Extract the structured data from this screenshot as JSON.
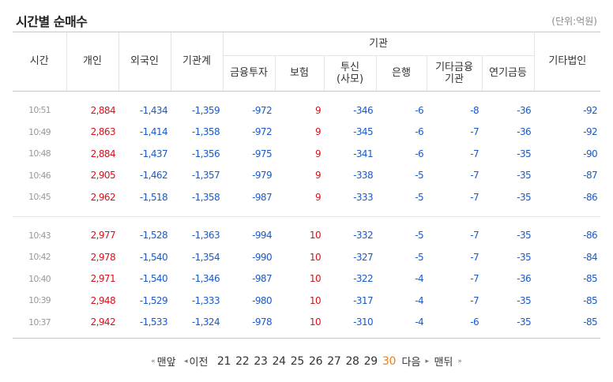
{
  "title": "시간별 순매수",
  "unit_label": "(단위:억원)",
  "columns": {
    "time": "시간",
    "individual": "개인",
    "foreign": "외국인",
    "institution_total": "기관계",
    "institution_group": "기관",
    "financial_invest": "금융투자",
    "insurance": "보험",
    "trust_line1": "투신",
    "trust_line2": "(사모)",
    "bank": "은행",
    "other_finance_line1": "기타금융",
    "other_finance_line2": "기관",
    "pension": "연기금등",
    "other_corp": "기타법인"
  },
  "rows": [
    [
      "10:51",
      "2,884",
      "-1,434",
      "-1,359",
      "-972",
      "9",
      "-346",
      "-6",
      "-8",
      "-36",
      "-92"
    ],
    [
      "10:49",
      "2,863",
      "-1,414",
      "-1,358",
      "-972",
      "9",
      "-345",
      "-6",
      "-7",
      "-36",
      "-92"
    ],
    [
      "10:48",
      "2,884",
      "-1,437",
      "-1,356",
      "-975",
      "9",
      "-341",
      "-6",
      "-7",
      "-35",
      "-90"
    ],
    [
      "10:46",
      "2,905",
      "-1,462",
      "-1,357",
      "-979",
      "9",
      "-338",
      "-5",
      "-7",
      "-35",
      "-87"
    ],
    [
      "10:45",
      "2,962",
      "-1,518",
      "-1,358",
      "-987",
      "9",
      "-333",
      "-5",
      "-7",
      "-35",
      "-86"
    ],
    [
      "10:43",
      "2,977",
      "-1,528",
      "-1,363",
      "-994",
      "10",
      "-332",
      "-5",
      "-7",
      "-35",
      "-86"
    ],
    [
      "10:42",
      "2,978",
      "-1,540",
      "-1,354",
      "-990",
      "10",
      "-327",
      "-5",
      "-7",
      "-35",
      "-84"
    ],
    [
      "10:40",
      "2,971",
      "-1,540",
      "-1,346",
      "-987",
      "10",
      "-322",
      "-4",
      "-7",
      "-36",
      "-85"
    ],
    [
      "10:39",
      "2,948",
      "-1,529",
      "-1,333",
      "-980",
      "10",
      "-317",
      "-4",
      "-7",
      "-35",
      "-85"
    ],
    [
      "10:37",
      "2,942",
      "-1,533",
      "-1,324",
      "-978",
      "10",
      "-310",
      "-4",
      "-6",
      "-35",
      "-85"
    ]
  ],
  "pagination": {
    "first_arrow": "«",
    "first_label": "맨앞",
    "prev_arrow": "◂",
    "prev_label": "이전",
    "pages": [
      "21",
      "22",
      "23",
      "24",
      "25",
      "26",
      "27",
      "28",
      "29",
      "30"
    ],
    "current_page": "30",
    "next_label": "다음",
    "next_arrow": "▸",
    "last_label": "맨뒤",
    "last_arrow": "»"
  },
  "colors": {
    "positive": "#d3121c",
    "negative": "#1a5ac8",
    "current_page": "#e8801e",
    "time_text": "#999999"
  }
}
